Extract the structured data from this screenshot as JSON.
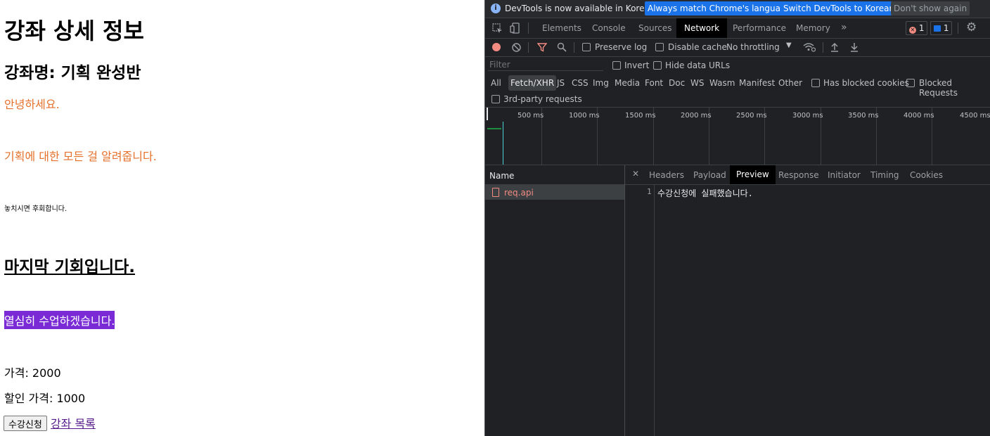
{
  "page": {
    "title": "강좌 상세 정보",
    "course_name": "강좌명: 기획 완성반",
    "line1": "안녕하세요.",
    "line2": "기획에 대한 모든 걸 알려줍니다.",
    "line3": "놓치시면 후회합니다.",
    "line4": "마지막 기회입니다.",
    "line5": "열심히 수업하겠습니다.",
    "price": "가격: 2000",
    "discount_price": "할인 가격: 1000",
    "enroll_button": "수강신청",
    "course_list_link": "강좌 목록"
  },
  "devtools": {
    "banner": {
      "message": "DevTools is now available in Korean!",
      "match_button": "Always match Chrome's language",
      "switch_button": "Switch DevTools to Korean",
      "dismiss_button": "Don't show again"
    },
    "tabs": [
      "Elements",
      "Console",
      "Sources",
      "Network",
      "Performance",
      "Memory"
    ],
    "active_tab": "Network",
    "error_count": "1",
    "message_count": "1",
    "toolbar": {
      "preserve_log": "Preserve log",
      "disable_cache": "Disable cache",
      "throttling": "No throttling"
    },
    "filter": {
      "placeholder": "Filter",
      "invert": "Invert",
      "hide_data_urls": "Hide data URLs"
    },
    "types": [
      "All",
      "Fetch/XHR",
      "JS",
      "CSS",
      "Img",
      "Media",
      "Font",
      "Doc",
      "WS",
      "Wasm",
      "Manifest",
      "Other"
    ],
    "active_type": "Fetch/XHR",
    "has_blocked_cookies": "Has blocked cookies",
    "blocked_requests": "Blocked Requests",
    "third_party": "3rd-party requests",
    "timeline_ticks": [
      "500 ms",
      "1000 ms",
      "1500 ms",
      "2000 ms",
      "2500 ms",
      "3000 ms",
      "3500 ms",
      "4000 ms",
      "4500 ms"
    ],
    "name_header": "Name",
    "request_name": "req.api",
    "detail_tabs": [
      "Headers",
      "Payload",
      "Preview",
      "Response",
      "Initiator",
      "Timing",
      "Cookies"
    ],
    "active_detail_tab": "Preview",
    "line_number": "1",
    "preview_text": "수강신청에 실패했습니다."
  },
  "colors": {
    "orange_text": "#e5702a",
    "purple_highlight": "#7a2bd6",
    "link": "#551a8b",
    "devtools_bg": "#202124",
    "error_red": "#f28b82",
    "accent_blue": "#1a73e8"
  }
}
